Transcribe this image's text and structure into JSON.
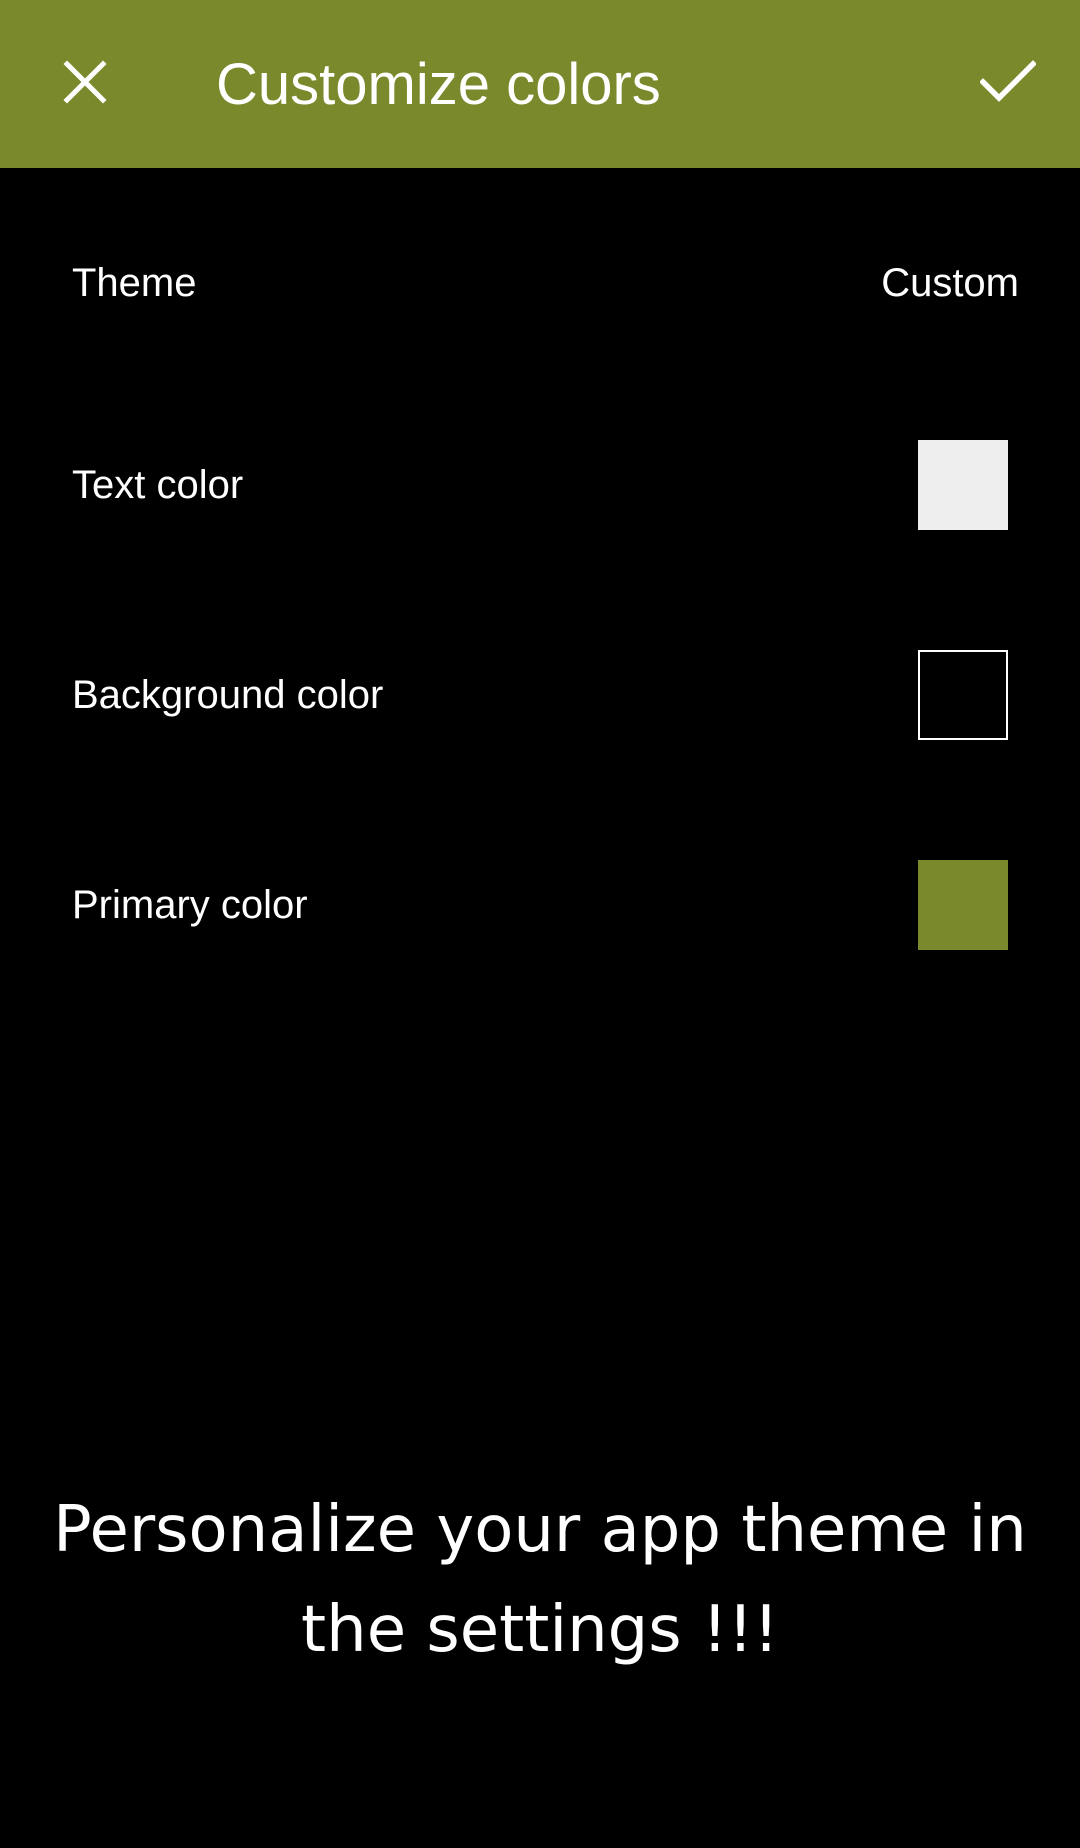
{
  "colors": {
    "primary": "#7a892b",
    "background": "#000000",
    "text": "#ffffff"
  },
  "toolbar": {
    "title": "Customize colors",
    "close_icon": "close-icon",
    "confirm_icon": "check-icon"
  },
  "settings": {
    "theme": {
      "label": "Theme",
      "value": "Custom"
    },
    "text_color": {
      "label": "Text color",
      "swatch": "#eeeeee"
    },
    "background_color": {
      "label": "Background color",
      "swatch": "#000000"
    },
    "primary_color": {
      "label": "Primary color",
      "swatch": "#7a892b"
    }
  },
  "promo": {
    "text": "Personalize your app theme in the settings !!!"
  }
}
